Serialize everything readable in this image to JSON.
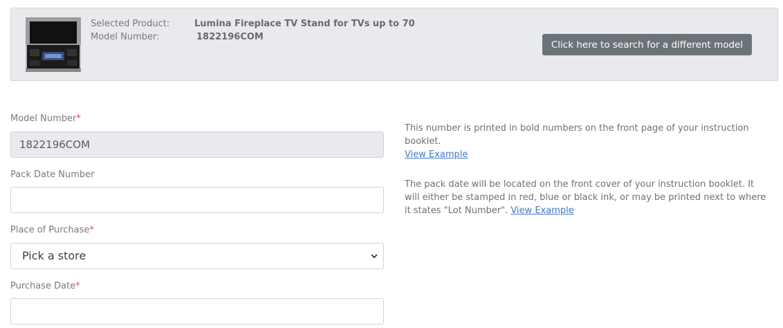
{
  "product": {
    "selected_label": "Selected Product:",
    "model_label": "Model Number:",
    "selected_value": "Lumina Fireplace TV Stand for TVs up to 70",
    "model_value": "1822196COM",
    "image_alt": "product-thumbnail",
    "search_button_label": "Click here to search for a different model"
  },
  "form": {
    "model_number": {
      "label": "Model Number",
      "required_mark": "*",
      "value": "1822196COM"
    },
    "pack_date": {
      "label": "Pack Date Number",
      "value": ""
    },
    "place_of_purchase": {
      "label": "Place of Purchase",
      "required_mark": "*",
      "selected": "Pick a store"
    },
    "purchase_date": {
      "label": "Purchase Date",
      "required_mark": "*",
      "value": ""
    }
  },
  "help": {
    "model_text": "This number is printed in bold numbers on the front page of your instruction booklet.",
    "model_link": "View Example",
    "pack_text": "The pack date will be located on the front cover of your instruction booklet. It will either be stamped in red, blue or black ink, or may be printed next to where it states \"Lot Number\".",
    "pack_link": "View Example"
  },
  "colors": {
    "panel_bg": "#e8eaed",
    "button_bg": "#6b7379",
    "required": "#d9534f",
    "link": "#3f78c7"
  }
}
